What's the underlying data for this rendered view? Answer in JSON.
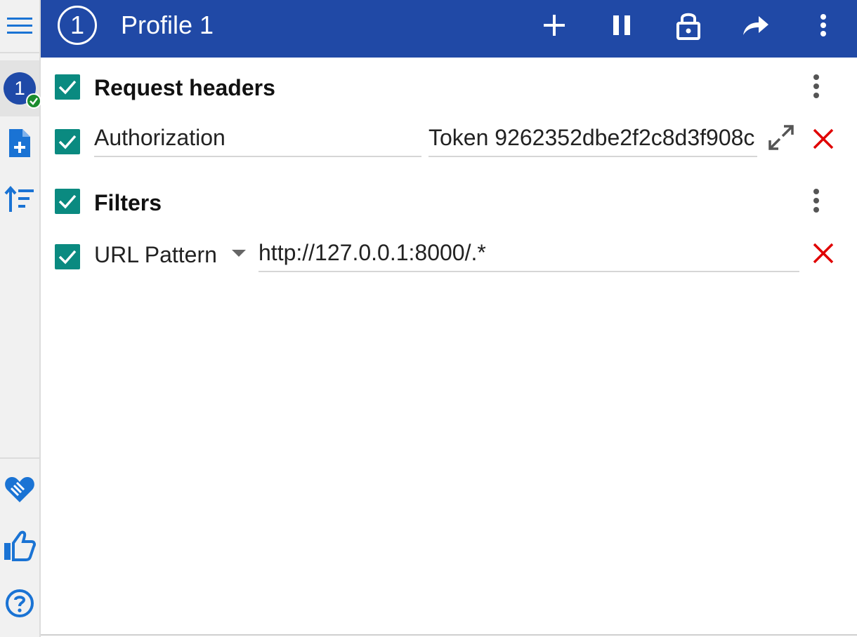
{
  "sidebar": {
    "profile_badge_number": "1",
    "items": [
      {
        "icon": "hamburger-menu-icon"
      },
      {
        "icon": "profile-active-icon"
      },
      {
        "icon": "add-file-icon"
      },
      {
        "icon": "sort-icon"
      },
      {
        "icon": "heart-handshake-icon"
      },
      {
        "icon": "thumbs-up-icon"
      },
      {
        "icon": "help-icon"
      }
    ]
  },
  "topbar": {
    "profile_number": "1",
    "title": "Profile 1",
    "actions": [
      "plus-icon",
      "pause-icon",
      "lock-icon",
      "share-icon",
      "more-vertical-icon"
    ]
  },
  "request_headers": {
    "title": "Request headers",
    "rows": [
      {
        "name": "Authorization",
        "value": "Token 9262352dbe2f2c8d3f908c"
      }
    ]
  },
  "filters": {
    "title": "Filters",
    "rows": [
      {
        "type": "URL Pattern",
        "value": "http://127.0.0.1:8000/.*"
      }
    ]
  },
  "colors": {
    "topbar": "#2049a6",
    "checkbox": "#0a8a80",
    "delete": "#e00000",
    "sidebar_icon": "#1a73d4"
  }
}
